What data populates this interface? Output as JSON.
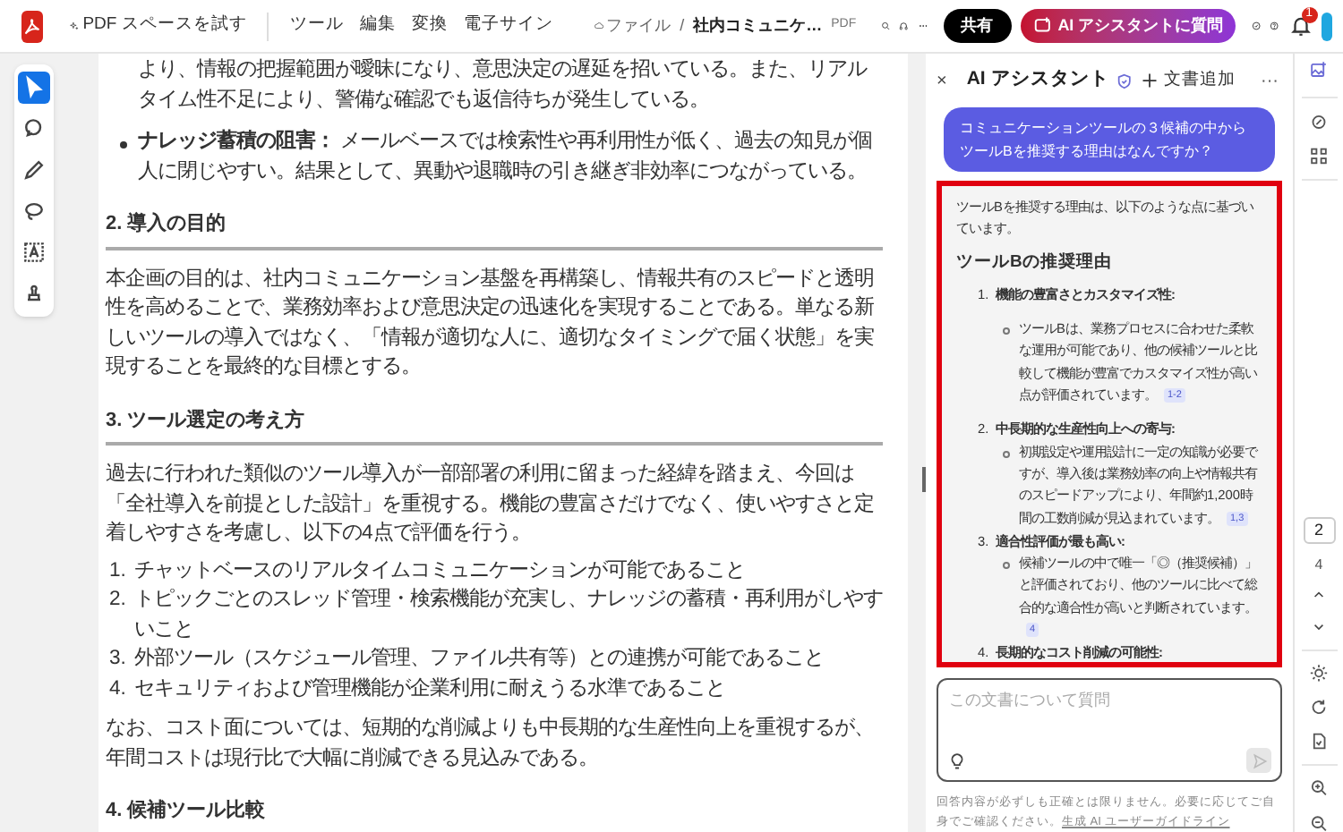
{
  "header": {
    "try_label": "PDF スペースを試す",
    "menu": [
      "ツール",
      "編集",
      "変換",
      "電子サイン"
    ],
    "breadcrumb_root": "ファイル",
    "breadcrumb_sep": "/",
    "file_name": "社内コミュニケ…",
    "file_type": "PDF",
    "share": "共有",
    "ai_button": "AI アシスタントに質問",
    "notification_count": "1"
  },
  "tools": [
    {
      "kind": "select",
      "selected": true
    },
    {
      "kind": "comment",
      "selected": false
    },
    {
      "kind": "pen",
      "selected": false
    },
    {
      "kind": "lasso",
      "selected": false
    },
    {
      "kind": "text",
      "selected": false
    },
    {
      "kind": "stamp",
      "selected": false
    }
  ],
  "document": [
    {
      "kind": "continuation",
      "text": "より、情報の把握範囲が曖昧になり、意思決定の遅延を招いている。また、リアルタイム性不足により、警備な確認でも返信待ちが発生している。"
    },
    {
      "kind": "bullet",
      "text": "**ナレッジ蓄積の阻害：** メールベースでは検索性や再利用性が低く、過去の知見が個人に閉じやすい。結果として、異動や退職時の引き継ぎ非効率につながっている。"
    },
    {
      "kind": "heading",
      "text": "2. 導入の目的"
    },
    {
      "kind": "paragraph",
      "text": "本企画の目的は、社内コミュニケーション基盤を再構築し、情報共有のスピードと透明性を高めることで、業務効率および意思決定の迅速化を実現することである。単なる新しいツールの導入ではなく、「情報が適切な人に、適切なタイミングで届く状態」を実現することを最終的な目標とする。"
    },
    {
      "kind": "heading",
      "text": "3. ツール選定の考え方"
    },
    {
      "kind": "paragraph",
      "text": "過去に行われた類似のツール導入が一部部署の利用に留まった経緯を踏まえ、今回は「全社導入を前提とした設計」を重視する。機能の豊富さだけでなく、使いやすさと定着しやすさを考慮し、以下の4点で評価を行う。"
    },
    {
      "kind": "numbered",
      "items": [
        {
          "number": "1.",
          "text": "チャットベースのリアルタイムコミュニケーションが可能であること"
        },
        {
          "number": "2.",
          "text": "トピックごとのスレッド管理・検索機能が充実し、ナレッジの蓄積・再利用がしやすいこと"
        },
        {
          "number": "3.",
          "text": "外部ツール（スケジュール管理、ファイル共有等）との連携が可能であること"
        },
        {
          "number": "4.",
          "text": "セキュリティおよび管理機能が企業利用に耐えうる水準であること"
        }
      ]
    },
    {
      "kind": "paragraph",
      "text": "なお、コスト面については、短期的な削減よりも中長期的な生産性向上を重視するが、年間コストは現行比で大幅に削減できる見込みである。"
    },
    {
      "kind": "heading",
      "text": "4. 候補ツール比較"
    }
  ],
  "assistant": {
    "close": "×",
    "title": "AI アシスタント",
    "add_document": "文書追加",
    "more": "···",
    "question": "コミュニケーションツールの３候補の中からツールBを推奨する理由はなんですか？",
    "answer": {
      "intro": "ツールBを推奨する理由は、以下のような点に基づいています。",
      "heading": "ツールBの推奨理由",
      "items": [
        {
          "number": "1.",
          "title": "機能の豊富さとカスタマイズ性:",
          "details": [
            {
              "text": "ツールBは、業務プロセスに合わせた柔軟な運用が可能であり、他の候補ツールと比較して機能が豊富でカスタマイズ性が高い点が評価されています。",
              "cite": "1-2"
            }
          ]
        },
        {
          "number": "2.",
          "title": "中長期的な生産性向上への寄与:",
          "details": [
            {
              "text": "初期設定や運用設計に一定の知識が必要ですが、導入後は業務効率の向上や情報共有のスピードアップにより、年間約1,200時間の工数削減が見込まれています。",
              "cite": "1,3"
            }
          ]
        },
        {
          "number": "3.",
          "title": "適合性評価が最も高い:",
          "details": [
            {
              "text": "候補ツールの中で唯一「◎（推奨候補）」と評価されており、他のツールに比べて総合的な適合性が高いと判断されています。",
              "cite": "4"
            }
          ]
        },
        {
          "number": "4.",
          "title": "長期的なコスト削減の可能性:"
        }
      ]
    },
    "input": {
      "placeholder": "この文書について質問"
    },
    "disclaimer": "回答内容が必ずしも正確とは限りません。必要に応じてご自身でご確認ください。",
    "guideline_link": "生成 AI ユーザーガイドライン"
  },
  "page_nav": {
    "current": "2",
    "total": "4"
  }
}
